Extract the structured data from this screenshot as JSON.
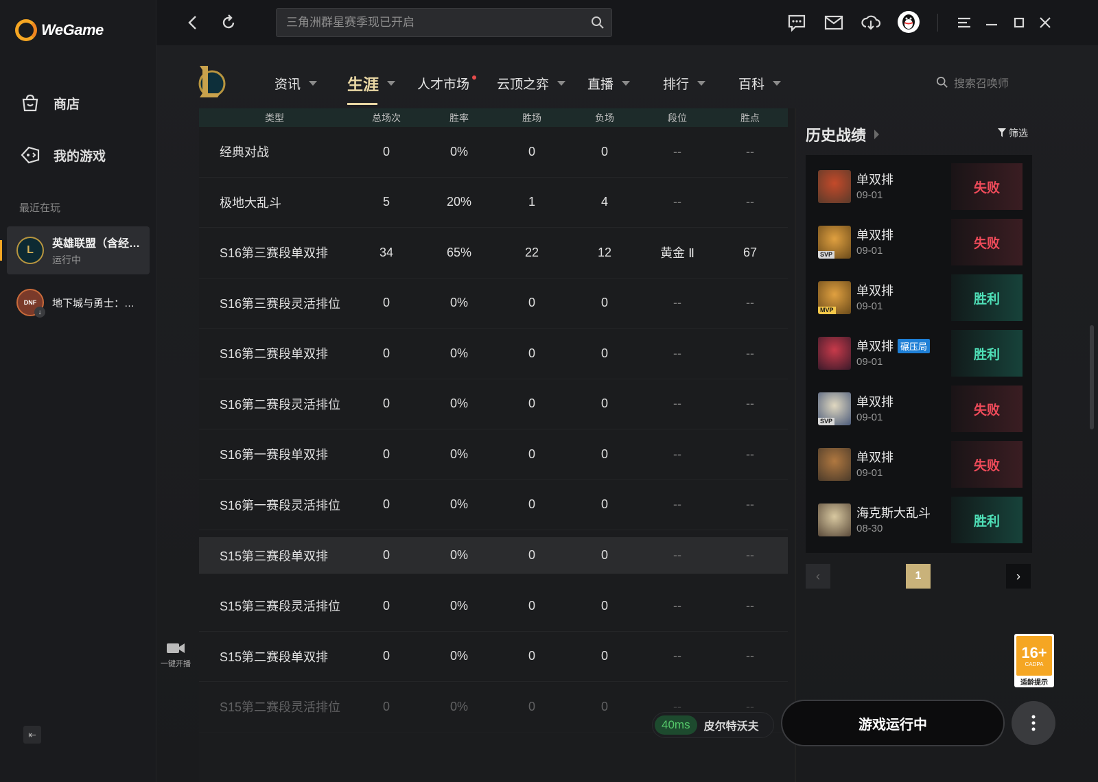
{
  "app": {
    "name": "WeGame"
  },
  "sidebar": {
    "nav": [
      {
        "label": "商店",
        "icon": "store-icon"
      },
      {
        "label": "我的游戏",
        "icon": "game-controller-icon"
      }
    ],
    "recent_title": "最近在玩",
    "recent_games": [
      {
        "name": "英雄联盟（含经…",
        "status": "运行中"
      },
      {
        "name": "地下城与勇士：…",
        "status": ""
      }
    ]
  },
  "topbar": {
    "search_placeholder": "三角洲群星赛季现已开启"
  },
  "game_nav": {
    "items": [
      {
        "label": "资讯"
      },
      {
        "label": "生涯"
      },
      {
        "label": "人才市场"
      },
      {
        "label": "云顶之弈"
      },
      {
        "label": "直播"
      },
      {
        "label": "排行"
      },
      {
        "label": "百科"
      }
    ],
    "search_placeholder": "搜索召唤师"
  },
  "stats_table": {
    "headers": [
      "类型",
      "总场次",
      "胜率",
      "胜场",
      "负场",
      "段位",
      "胜点"
    ],
    "rows": [
      [
        "经典对战",
        "0",
        "0%",
        "0",
        "0",
        "--",
        "--"
      ],
      [
        "极地大乱斗",
        "5",
        "20%",
        "1",
        "4",
        "--",
        "--"
      ],
      [
        "S16第三赛段单双排",
        "34",
        "65%",
        "22",
        "12",
        "黄金 Ⅱ",
        "67"
      ],
      [
        "S16第三赛段灵活排位",
        "0",
        "0%",
        "0",
        "0",
        "--",
        "--"
      ],
      [
        "S16第二赛段单双排",
        "0",
        "0%",
        "0",
        "0",
        "--",
        "--"
      ],
      [
        "S16第二赛段灵活排位",
        "0",
        "0%",
        "0",
        "0",
        "--",
        "--"
      ],
      [
        "S16第一赛段单双排",
        "0",
        "0%",
        "0",
        "0",
        "--",
        "--"
      ],
      [
        "S16第一赛段灵活排位",
        "0",
        "0%",
        "0",
        "0",
        "--",
        "--"
      ],
      [
        "S15第三赛段单双排",
        "0",
        "0%",
        "0",
        "0",
        "--",
        "--"
      ],
      [
        "S15第三赛段灵活排位",
        "0",
        "0%",
        "0",
        "0",
        "--",
        "--"
      ],
      [
        "S15第二赛段单双排",
        "0",
        "0%",
        "0",
        "0",
        "--",
        "--"
      ],
      [
        "S15第二赛段灵活排位",
        "0",
        "0%",
        "0",
        "0",
        "--",
        "--"
      ]
    ]
  },
  "live_button": {
    "label": "一键开播"
  },
  "history": {
    "title": "历史战绩",
    "filter_label": "筛选",
    "matches": [
      {
        "mode": "单双排",
        "date": "09-01",
        "result": "失败",
        "outcome": "lose",
        "tag": "",
        "badge": ""
      },
      {
        "mode": "单双排",
        "date": "09-01",
        "result": "失败",
        "outcome": "lose",
        "tag": "SVP",
        "badge": ""
      },
      {
        "mode": "单双排",
        "date": "09-01",
        "result": "胜利",
        "outcome": "win",
        "tag": "MVP",
        "badge": ""
      },
      {
        "mode": "单双排",
        "date": "09-01",
        "result": "胜利",
        "outcome": "win",
        "tag": "",
        "badge": "碾压局"
      },
      {
        "mode": "单双排",
        "date": "09-01",
        "result": "失败",
        "outcome": "lose",
        "tag": "SVP",
        "badge": ""
      },
      {
        "mode": "单双排",
        "date": "09-01",
        "result": "失败",
        "outcome": "lose",
        "tag": "",
        "badge": ""
      },
      {
        "mode": "海克斯大乱斗",
        "date": "08-30",
        "result": "胜利",
        "outcome": "win",
        "tag": "",
        "badge": ""
      }
    ],
    "page": "1"
  },
  "status": {
    "ping": "40ms",
    "server": "皮尔特沃夫",
    "play_button": "游戏运行中"
  },
  "age_rating": {
    "value": "16+",
    "org": "CADPA",
    "tip": "适龄提示"
  },
  "colors": {
    "accent_gold": "#e9d7a4",
    "lose": "#ef4b5a",
    "win": "#4fe0b8",
    "brand": "#f5a623"
  }
}
